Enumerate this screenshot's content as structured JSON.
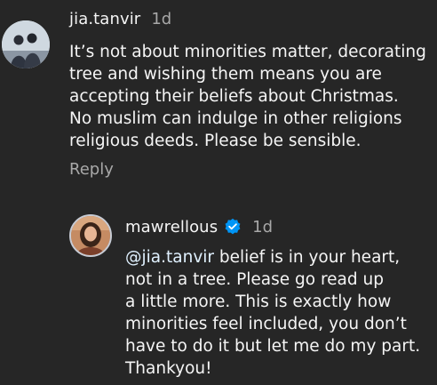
{
  "comments": [
    {
      "username": "jia.tanvir",
      "time": "1d",
      "avatar": "profile-photo-two-people",
      "lines": [
        "It’s not about minorities matter, decorating",
        "tree and wishing them means you are",
        "accepting their beliefs about Christmas.",
        "No muslim can indulge in other religions",
        "religious deeds. Please be sensible."
      ],
      "reply_label": "Reply"
    },
    {
      "username": "mawrellous",
      "verified": true,
      "verified_color": "#0095f6",
      "time": "1d",
      "avatar": "profile-photo-woman",
      "mention": "@jia.tanvir",
      "first_line_rest": " belief is in your heart,",
      "lines": [
        "not in a tree. Please go read up",
        "a little more. This is exactly how",
        "minorities feel included, you don’t",
        "have to do it but let me do my part.",
        "Thankyou!"
      ]
    }
  ],
  "colors": {
    "background": "#262626",
    "primary_text": "#f5f5f5",
    "secondary_text": "#a8a8a8"
  }
}
